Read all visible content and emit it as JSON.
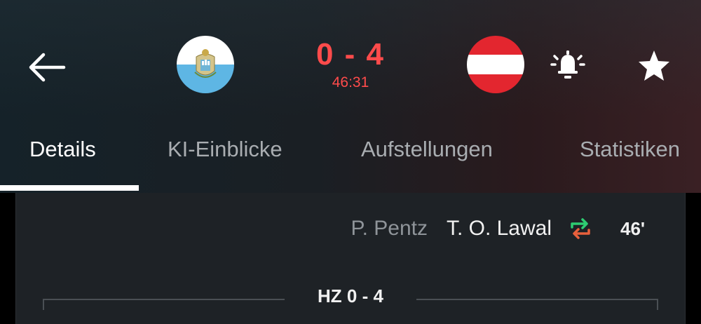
{
  "match": {
    "home_team_flag": "san-marino-flag",
    "away_team_flag": "austria-flag",
    "score": "0 - 4",
    "clock": "46:31",
    "score_color": "#ff4b4b"
  },
  "header_actions": {
    "back": "arrow-left-icon",
    "notifications": "bell-ringing-icon",
    "favorite": "star-icon"
  },
  "tabs": [
    {
      "label": "Details",
      "active": true
    },
    {
      "label": "KI-Einblicke",
      "active": false
    },
    {
      "label": "Aufstellungen",
      "active": false
    },
    {
      "label": "Statistiken",
      "active": false
    }
  ],
  "events": [
    {
      "type": "substitution",
      "player_out": "P. Pentz",
      "player_in": "T. O. Lawal",
      "minute": "46'",
      "icon": "substitution-arrows-icon"
    }
  ],
  "halftime": {
    "label": "HZ 0 - 4"
  }
}
